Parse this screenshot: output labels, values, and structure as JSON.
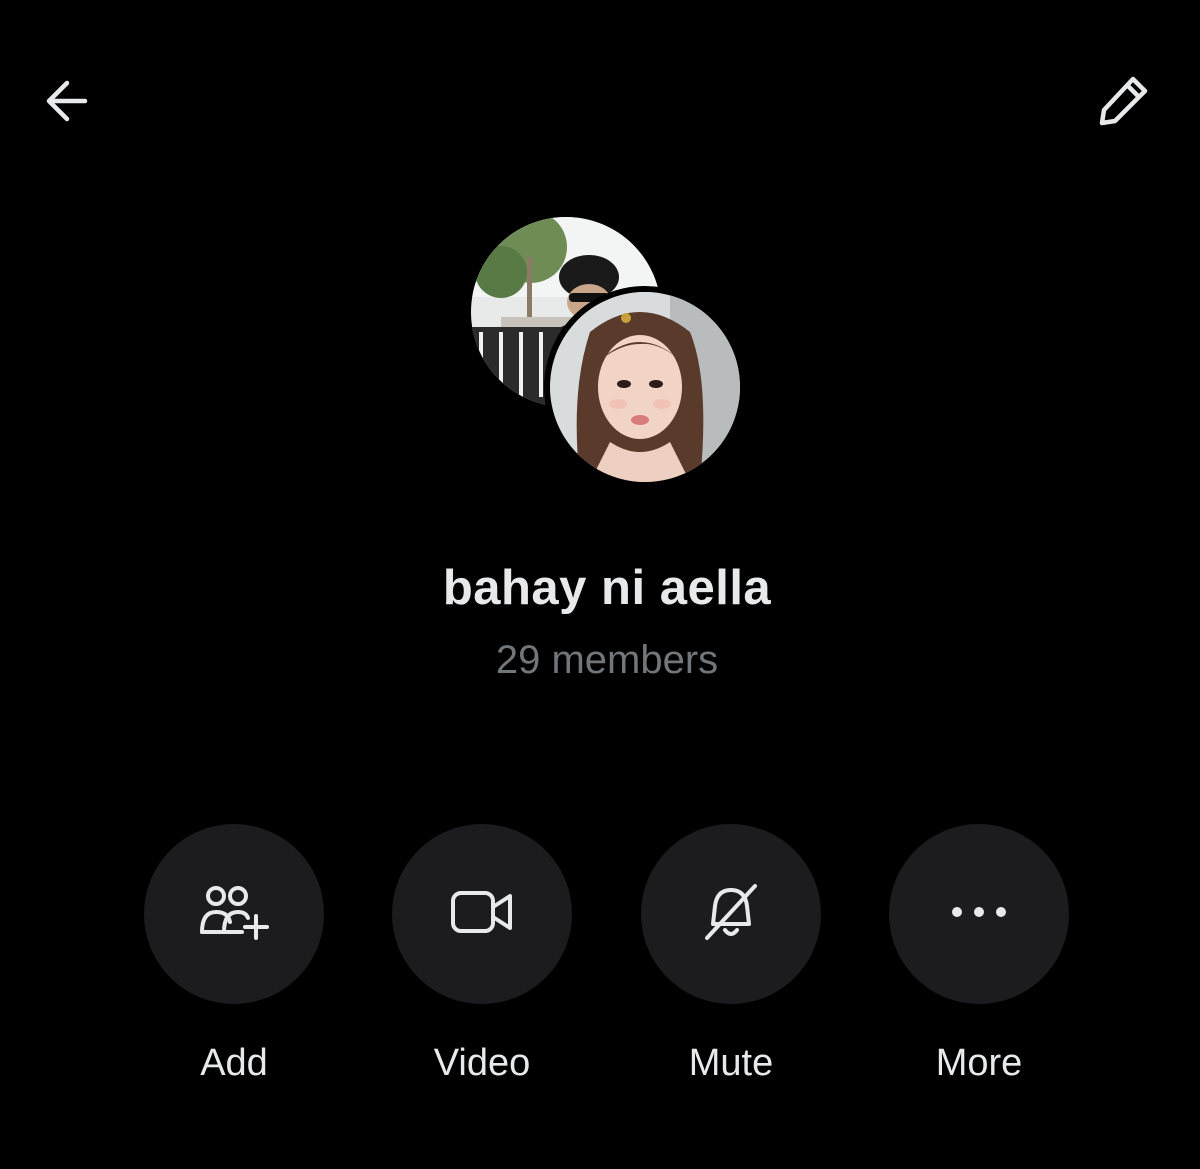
{
  "header": {
    "back_icon": "arrow-left-icon",
    "edit_icon": "pencil-icon"
  },
  "group": {
    "name": "bahay ni aella",
    "member_count": "29 members"
  },
  "actions": [
    {
      "label": "Add",
      "icon": "add-people-icon"
    },
    {
      "label": "Video",
      "icon": "video-camera-icon"
    },
    {
      "label": "Mute",
      "icon": "bell-muted-icon"
    },
    {
      "label": "More",
      "icon": "more-dots-icon"
    }
  ],
  "colors": {
    "background": "#000000",
    "primary_text": "#e7e9ea",
    "secondary_text": "#71767b",
    "button_bg": "#1c1c1f"
  }
}
